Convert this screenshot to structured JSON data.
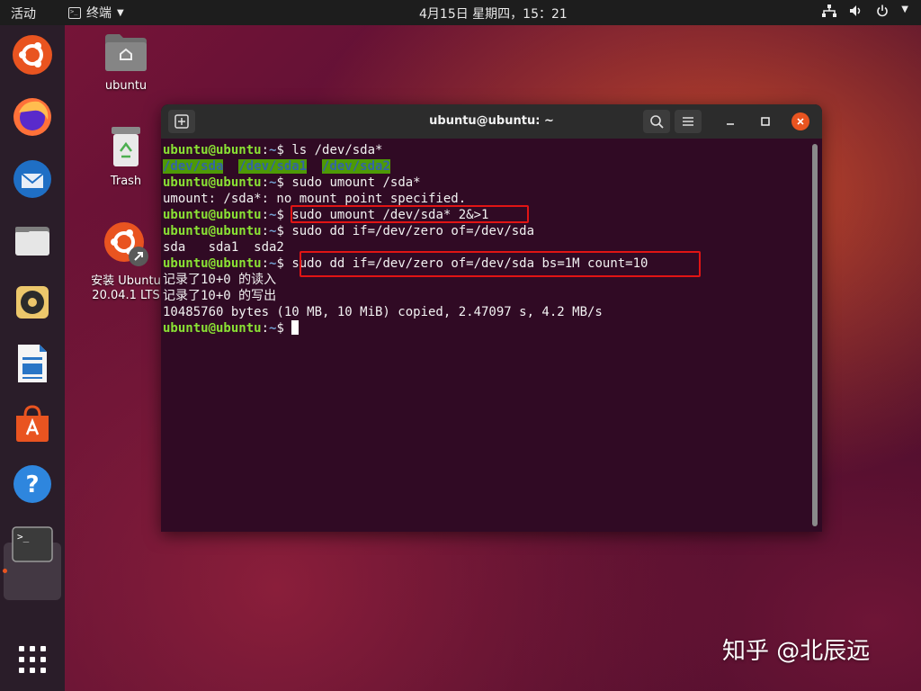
{
  "topbar": {
    "activities": "活动",
    "app_name": "终端",
    "clock": "4月15日 星期四，15：21"
  },
  "desktop": {
    "home_label": "ubuntu",
    "trash_label": "Trash",
    "install_label_1": "安装 Ubuntu",
    "install_label_2": "20.04.1 LTS"
  },
  "terminal": {
    "title": "ubuntu@ubuntu: ~",
    "prompt_user": "ubuntu@ubuntu",
    "prompt_colon": ":",
    "prompt_path": "~",
    "prompt_dollar": "$",
    "lines": [
      {
        "cmd": " ls /dev/sda*"
      },
      {
        "out": [
          "/dev/sda",
          "/dev/sda1",
          "/dev/sda2"
        ]
      },
      {
        "cmd": " sudo umount /sda*"
      },
      {
        "text": "umount: /sda*: no mount point specified."
      },
      {
        "cmd": " sudo umount /dev/sda* 2&>1"
      },
      {
        "cmd": " sudo dd if=/dev/zero of=/dev/sda"
      },
      {
        "text": "sda   sda1  sda2"
      },
      {
        "cmd": " sudo dd if=/dev/zero of=/dev/sda bs=1M count=10"
      },
      {
        "text": "记录了10+0 的读入"
      },
      {
        "text": "记录了10+0 的写出"
      },
      {
        "text": "10485760 bytes (10 MB, 10 MiB) copied, 2.47097 s, 4.2 MB/s"
      }
    ]
  },
  "watermark": "知乎 @北辰远",
  "colors": {
    "accent": "#e95420",
    "terminal_bg": "#300a24",
    "prompt_user": "#8ae234",
    "prompt_path": "#729fcf",
    "highlight_border": "#e11414"
  },
  "icons": {
    "dock": [
      "ubuntu-installer-icon",
      "firefox-icon",
      "thunderbird-icon",
      "files-icon",
      "rhythmbox-icon",
      "writer-icon",
      "software-icon",
      "help-icon",
      "terminal-icon",
      "app-grid-icon"
    ],
    "system": [
      "network-icon",
      "volume-icon",
      "power-icon"
    ]
  }
}
